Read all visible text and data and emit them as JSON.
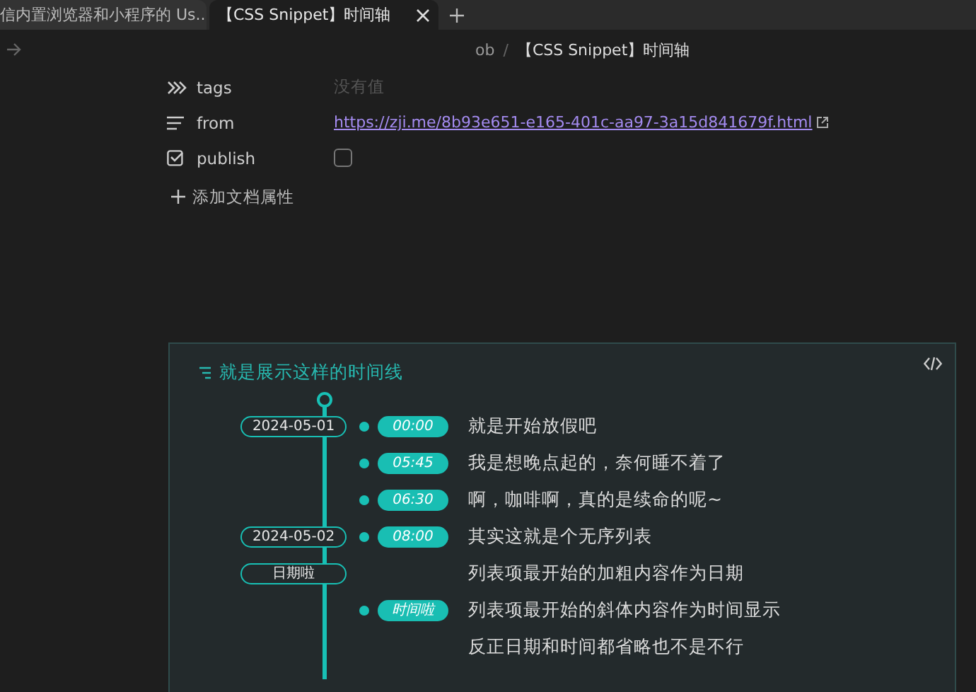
{
  "tabs": [
    {
      "label": "信内置浏览器和小程序的 Us...",
      "selected": false
    },
    {
      "label": "【CSS Snippet】时间轴",
      "selected": true
    }
  ],
  "breadcrumb": {
    "parts": [
      "ob",
      "【CSS Snippet】时间轴"
    ],
    "separator": "/"
  },
  "properties": [
    {
      "kind": "tags",
      "name": "tags",
      "placeholder": "没有值"
    },
    {
      "kind": "link",
      "name": "from",
      "value": "https://zji.me/8b93e651-e165-401c-aa97-3a15d841679f.html"
    },
    {
      "kind": "checkbox",
      "name": "publish",
      "checked": false
    }
  ],
  "add_property": "添加文档属性",
  "callout": {
    "title": "就是展示这样的时间线",
    "items": [
      {
        "date": "2024-05-01",
        "time": "00:00",
        "text": "就是开始放假吧"
      },
      {
        "time": "05:45",
        "text": "我是想晚点起的，奈何睡不着了"
      },
      {
        "time": "06:30",
        "text": "啊，咖啡啊，真的是续命的呢~"
      },
      {
        "date": "2024-05-02",
        "time": "08:00",
        "text": "其实这就是个无序列表"
      },
      {
        "date": "日期啦",
        "text": "列表项最开始的加粗内容作为日期"
      },
      {
        "time": "时间啦",
        "text": "列表项最开始的斜体内容作为时间显示"
      },
      {
        "text": "反正日期和时间都省略也不是不行"
      }
    ]
  }
}
